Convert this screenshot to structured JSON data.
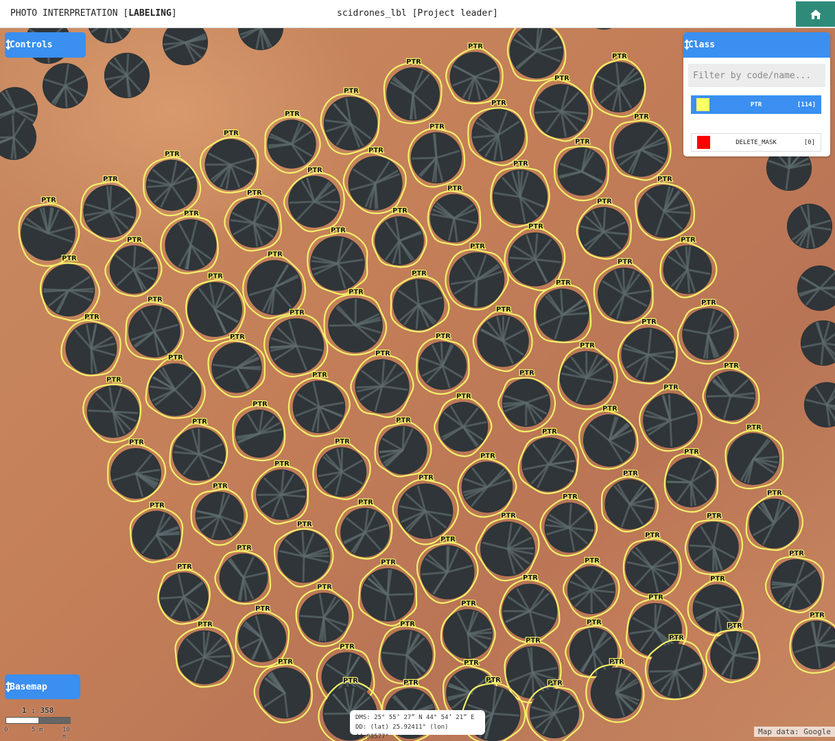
{
  "header": {
    "title_prefix": "PHOTO INTERPRETATION [",
    "title_mode": "LABELING",
    "title_suffix": "]",
    "user": "scidrones_lbl [Project leader]",
    "home_icon": "home-icon"
  },
  "controls": {
    "label": "Controls",
    "icon": "sort-arrows-icon"
  },
  "basemap": {
    "label": "Basemap",
    "icon": "sort-arrows-icon"
  },
  "class_panel": {
    "title": "Class",
    "filter_placeholder": "Filter by code/name...",
    "items": [
      {
        "name": "PTR",
        "count": "[114]",
        "color": "#ffff66",
        "selected": true
      },
      {
        "name": "DELETE_MASK",
        "count": "[0]",
        "color": "#ff0000",
        "selected": false
      }
    ]
  },
  "scale": {
    "ratio": "1 : 358",
    "ticks": [
      "0",
      "5 m",
      "10 m"
    ]
  },
  "coordinates": {
    "dms": "DMS: 25° 55’ 27” N 44° 54’ 21” E",
    "dd": "DD: (lat) 25.92411° (lon) 44.90577°"
  },
  "attribution": "Map data: Google",
  "annotation": {
    "label": "PTR",
    "outline_color": "#f4f06a",
    "rows": [
      [
        [
          70,
          340
        ],
        [
          160,
          308
        ],
        [
          250,
          270
        ],
        [
          336,
          240
        ],
        [
          425,
          210
        ],
        [
          511,
          180
        ],
        [
          602,
          137
        ],
        [
          692,
          112
        ],
        [
          782,
          75
        ]
      ],
      [
        [
          100,
          423
        ],
        [
          195,
          393
        ],
        [
          278,
          357
        ],
        [
          370,
          325
        ],
        [
          458,
          294
        ],
        [
          547,
          267
        ],
        [
          636,
          230
        ],
        [
          726,
          197
        ],
        [
          818,
          162
        ],
        [
          902,
          127
        ]
      ],
      [
        [
          133,
          508
        ],
        [
          225,
          483
        ],
        [
          313,
          451
        ],
        [
          400,
          419
        ],
        [
          492,
          384
        ],
        [
          582,
          351
        ],
        [
          662,
          318
        ],
        [
          758,
          287
        ],
        [
          848,
          250
        ],
        [
          934,
          218
        ]
      ],
      [
        [
          165,
          600
        ],
        [
          255,
          568
        ],
        [
          345,
          536
        ],
        [
          432,
          504
        ],
        [
          518,
          474
        ],
        [
          610,
          444
        ],
        [
          695,
          408
        ],
        [
          780,
          378
        ],
        [
          880,
          338
        ],
        [
          968,
          308
        ]
      ],
      [
        [
          198,
          690
        ],
        [
          290,
          662
        ],
        [
          378,
          632
        ],
        [
          465,
          593
        ],
        [
          557,
          563
        ],
        [
          645,
          533
        ],
        [
          733,
          497
        ],
        [
          820,
          459
        ],
        [
          910,
          429
        ],
        [
          1002,
          393
        ]
      ],
      [
        [
          228,
          780
        ],
        [
          320,
          752
        ],
        [
          410,
          721
        ],
        [
          498,
          688
        ],
        [
          587,
          656
        ],
        [
          675,
          622
        ],
        [
          767,
          587
        ],
        [
          855,
          551
        ],
        [
          945,
          517
        ],
        [
          1032,
          487
        ]
      ],
      [
        [
          268,
          870
        ],
        [
          355,
          842
        ],
        [
          443,
          811
        ],
        [
          532,
          776
        ],
        [
          620,
          745
        ],
        [
          710,
          710
        ],
        [
          800,
          677
        ],
        [
          888,
          642
        ],
        [
          977,
          613
        ],
        [
          1065,
          577
        ]
      ],
      [
        [
          298,
          958
        ],
        [
          382,
          930
        ],
        [
          472,
          900
        ],
        [
          565,
          867
        ],
        [
          652,
          834
        ],
        [
          740,
          800
        ],
        [
          830,
          769
        ],
        [
          918,
          735
        ],
        [
          1007,
          703
        ],
        [
          1098,
          669
        ]
      ],
      [
        [
          415,
          1010
        ],
        [
          505,
          987
        ],
        [
          593,
          955
        ],
        [
          682,
          924
        ],
        [
          772,
          891
        ],
        [
          862,
          860
        ],
        [
          950,
          827
        ],
        [
          1040,
          797
        ],
        [
          1128,
          763
        ]
      ],
      [
        [
          510,
          1040
        ],
        [
          598,
          1040
        ],
        [
          686,
          1010
        ],
        [
          776,
          980
        ],
        [
          865,
          950
        ],
        [
          955,
          918
        ],
        [
          1045,
          887
        ],
        [
          1160,
          852
        ]
      ],
      [
        [
          718,
          1040
        ],
        [
          808,
          1040
        ],
        [
          898,
          1010
        ],
        [
          985,
          978
        ],
        [
          1070,
          955
        ],
        [
          1190,
          940
        ]
      ]
    ]
  },
  "unlabeled_trees": [
    [
      70,
      60
    ],
    [
      160,
      30
    ],
    [
      270,
      62
    ],
    [
      380,
      40
    ],
    [
      95,
      125
    ],
    [
      185,
      110
    ],
    [
      22,
      160
    ],
    [
      20,
      200
    ],
    [
      1150,
      245
    ],
    [
      1180,
      330
    ],
    [
      1195,
      420
    ],
    [
      1200,
      500
    ],
    [
      1205,
      590
    ],
    [
      880,
      10
    ],
    [
      200,
      5
    ],
    [
      440,
      8
    ]
  ]
}
